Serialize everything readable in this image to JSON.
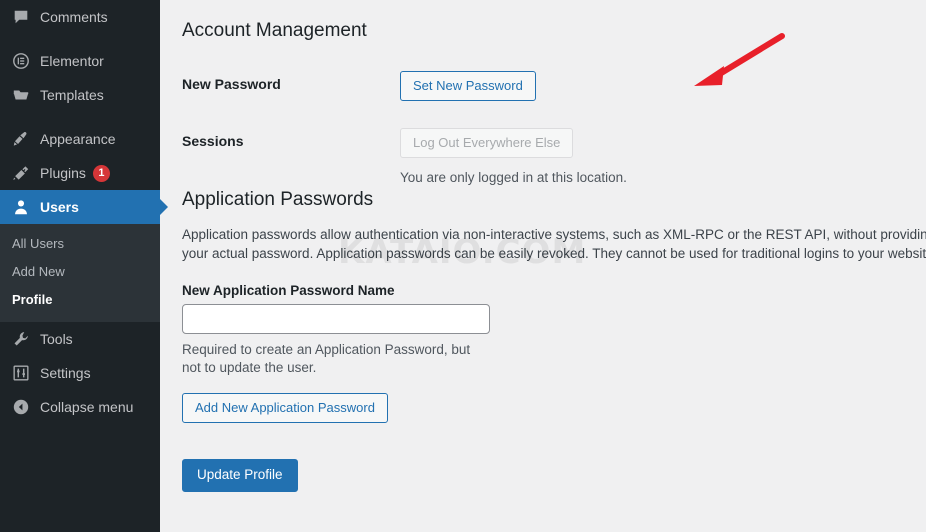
{
  "sidebar": {
    "items": [
      {
        "label": "Comments",
        "icon": "comments-icon",
        "active": false,
        "badge": null
      },
      {
        "label": "Elementor",
        "icon": "elementor-icon",
        "active": false,
        "badge": null
      },
      {
        "label": "Templates",
        "icon": "templates-folder-icon",
        "active": false,
        "badge": null
      },
      {
        "label": "Appearance",
        "icon": "appearance-brush-icon",
        "active": false,
        "badge": null
      },
      {
        "label": "Plugins",
        "icon": "plugins-plug-icon",
        "active": false,
        "badge": "1"
      },
      {
        "label": "Users",
        "icon": "users-person-icon",
        "active": true,
        "badge": null
      },
      {
        "label": "Tools",
        "icon": "tools-wrench-icon",
        "active": false,
        "badge": null
      },
      {
        "label": "Settings",
        "icon": "settings-sliders-icon",
        "active": false,
        "badge": null
      },
      {
        "label": "Collapse menu",
        "icon": "collapse-arrow-icon",
        "active": false,
        "badge": null
      }
    ],
    "submenu": [
      {
        "label": "All Users",
        "current": false
      },
      {
        "label": "Add New",
        "current": false
      },
      {
        "label": "Profile",
        "current": true
      }
    ]
  },
  "account_management": {
    "title": "Account Management",
    "new_password_label": "New Password",
    "set_new_password_button": "Set New Password",
    "sessions_label": "Sessions",
    "log_out_everywhere_button": "Log Out Everywhere Else",
    "sessions_help": "You are only logged in at this location."
  },
  "application_passwords": {
    "title": "Application Passwords",
    "description": "Application passwords allow authentication via non-interactive systems, such as XML-RPC or the REST API, without providing your actual password. Application passwords can be easily revoked. They cannot be used for traditional logins to your website.",
    "name_field_label": "New Application Password Name",
    "name_field_value": "",
    "name_field_placeholder": "",
    "name_field_help": "Required to create an Application Password, but not to update the user.",
    "add_button": "Add New Application Password"
  },
  "footer": {
    "update_profile_button": "Update Profile"
  },
  "watermark": {
    "text": "KATAIO.COM"
  },
  "colors": {
    "accent_blue": "#2271b1",
    "sidebar_bg": "#1d2327",
    "submenu_bg": "#2c3338",
    "content_bg": "#f0f0f1",
    "badge_red": "#d63638",
    "annotation_red": "#e8202a"
  }
}
